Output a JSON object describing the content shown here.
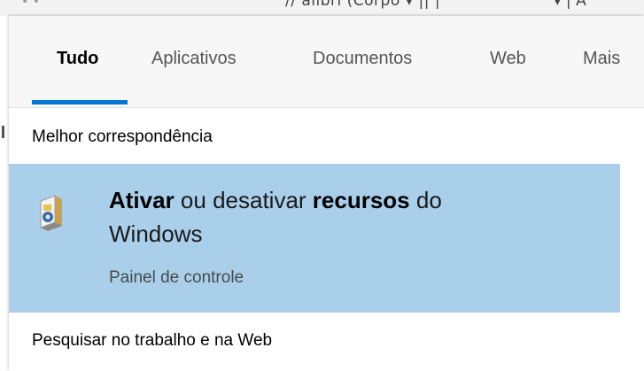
{
  "background_app": {
    "toolbar_text": "// alibri (Corpo ▾ || |",
    "toolbar_text_right": "▾ | A"
  },
  "search": {
    "tabs": [
      {
        "label": "Tudo",
        "active": true
      },
      {
        "label": "Aplicativos",
        "active": false
      },
      {
        "label": "Documentos",
        "active": false
      },
      {
        "label": "Web",
        "active": false
      },
      {
        "label": "Mais",
        "active": false
      }
    ],
    "best_match_heading": "Melhor correspondência",
    "best_match": {
      "title_parts": [
        {
          "text": "Ativar",
          "bold": true
        },
        {
          "text": " ou desativar ",
          "bold": false
        },
        {
          "text": "recursos",
          "bold": true
        },
        {
          "text": " do Windows",
          "bold": false
        }
      ],
      "subtitle": "Painel de controle",
      "icon": "windows-features-icon"
    },
    "web_heading": "Pesquisar no trabalho e na Web"
  },
  "colors": {
    "accent": "#0078d7",
    "selection": "#a9cfeb",
    "tab_bar": "#f7f7f7"
  }
}
